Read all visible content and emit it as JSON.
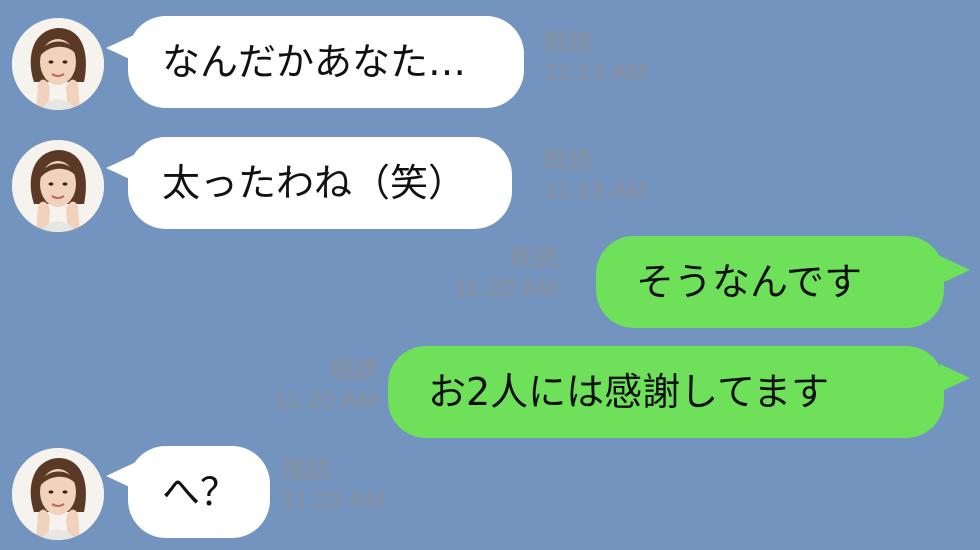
{
  "messages": [
    {
      "side": "in",
      "text": "なんだかあなた…",
      "read": "既読",
      "time": "11:13 AM"
    },
    {
      "side": "in",
      "text": "太ったわね（笑）",
      "read": "既読",
      "time": "11:13 AM"
    },
    {
      "side": "out",
      "text": "そうなんです",
      "read": "既読",
      "time": "11:20 AM"
    },
    {
      "side": "out",
      "text": "お2人には感謝してます",
      "read": "既読",
      "time": "11:20 AM"
    },
    {
      "side": "in",
      "text": "へ？",
      "read": "既読",
      "time": "11:23 AM"
    }
  ],
  "colors": {
    "background": "#7494c0",
    "incoming_bubble": "#ffffff",
    "outgoing_bubble": "#6ee05a",
    "meta_text": "#8b8f98"
  }
}
